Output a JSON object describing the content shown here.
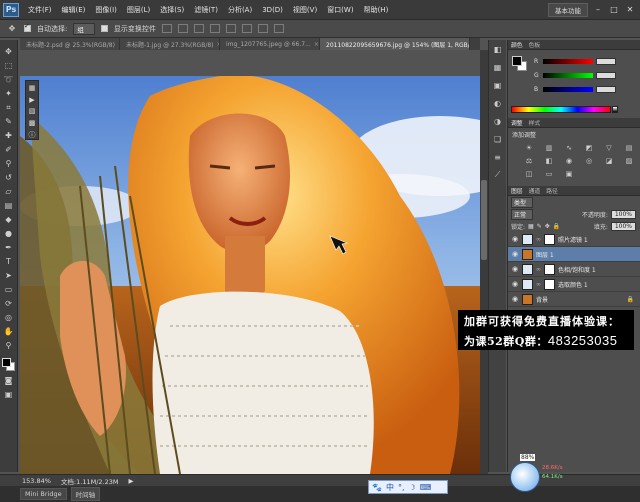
{
  "app": {
    "logo": "Ps",
    "menu": [
      "文件(F)",
      "编辑(E)",
      "图像(I)",
      "图层(L)",
      "选择(S)",
      "滤镜(T)",
      "分析(A)",
      "3D(D)",
      "视图(V)",
      "窗口(W)",
      "帮助(H)"
    ],
    "workspace": "基本功能"
  },
  "options": {
    "auto_select_label": "自动选择:",
    "auto_select_value": "组",
    "show_transform_label": "显示变换控件"
  },
  "tabs": [
    {
      "label": "未标题-2.psd @ 25.3%(RGB/8)",
      "active": false
    },
    {
      "label": "未标题-1.jpg @ 27.3%(RGB/8)",
      "active": false
    },
    {
      "label": "img_1207765.jpeg @ 66.7...",
      "active": false
    },
    {
      "label": "20110822095659676.jpg @ 154% (图层 1, RGB/8#)",
      "active": true
    }
  ],
  "panels": {
    "color_tabs": [
      "颜色",
      "色板"
    ],
    "color_labels": [
      "R",
      "G",
      "B"
    ],
    "adj_tabs": [
      "调整",
      "样式"
    ],
    "adj_title": "添加调整",
    "layer_tabs": [
      "图层",
      "通道",
      "路径"
    ],
    "filter_label": "类型",
    "blend_mode": "正常",
    "opacity_label": "不透明度:",
    "opacity_value": "100%",
    "lock_label": "锁定:",
    "fill_label": "填充:",
    "fill_value": "100%",
    "layers": [
      {
        "name": "照片滤镜 1",
        "selected": false,
        "thumb": "#ffffff"
      },
      {
        "name": "图层 1",
        "selected": true,
        "thumb": "#c8772a"
      },
      {
        "name": "色相/饱和度 1",
        "selected": false,
        "thumb": "#ffffff"
      },
      {
        "name": "选取颜色 1",
        "selected": false,
        "thumb": "#ffffff"
      },
      {
        "name": "背景",
        "selected": false,
        "thumb": "#c8772a"
      }
    ]
  },
  "status": {
    "zoom": "153.84%",
    "doc": "文档:1.11M/2.23M"
  },
  "bottom_tabs": [
    "Mini Bridge",
    "时间轴"
  ],
  "promo": {
    "line1": "加群可获得免费直播体验课：",
    "line2_prefix": "为课52群Q群：",
    "line2_number": "483253035"
  },
  "ime": {
    "label": "中"
  },
  "net": {
    "percent": "88%",
    "up": "28.6K/s",
    "down": "64.1K/s"
  },
  "colors": {
    "accent": "#5d7ea8",
    "menubar": "#3a3a3a",
    "panel": "#4e4e4e"
  }
}
